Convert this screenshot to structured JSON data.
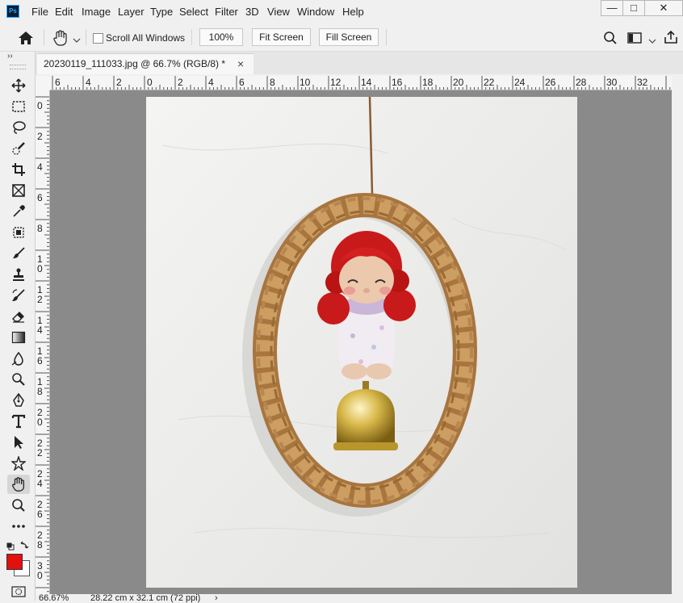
{
  "app": {
    "logo_text": "Ps"
  },
  "menu": [
    "File",
    "Edit",
    "Image",
    "Layer",
    "Type",
    "Select",
    "Filter",
    "3D",
    "View",
    "Window",
    "Help"
  ],
  "window_controls": {
    "minimize": "—",
    "restore": "□",
    "close": "✕"
  },
  "options_bar": {
    "scroll_all_label": "Scroll All Windows",
    "scroll_all_checked": false,
    "zoom_value": "100%",
    "fit_screen_label": "Fit Screen",
    "fill_screen_label": "Fill Screen"
  },
  "document": {
    "tab_title": "20230119_111033.jpg @ 66.7% (RGB/8) *",
    "close_glyph": "×"
  },
  "ruler": {
    "h_labels": [
      "6",
      "4",
      "2",
      "0",
      "2",
      "4",
      "6",
      "8",
      "10",
      "12",
      "14",
      "16",
      "18",
      "20",
      "22",
      "24",
      "26",
      "28",
      "30",
      "32"
    ],
    "v_labels": [
      "0",
      "2",
      "4",
      "6",
      "8",
      "10",
      "12",
      "14",
      "16",
      "18",
      "20",
      "22",
      "24",
      "26",
      "28",
      "30"
    ]
  },
  "status": {
    "zoom": "66.67%",
    "doc_size": "28.22 cm x 32.1 cm (72 ppi)",
    "arrow": "›"
  },
  "colors": {
    "foreground": "#e31010",
    "background": "#ffffff",
    "canvas": "#8a8a8a"
  }
}
